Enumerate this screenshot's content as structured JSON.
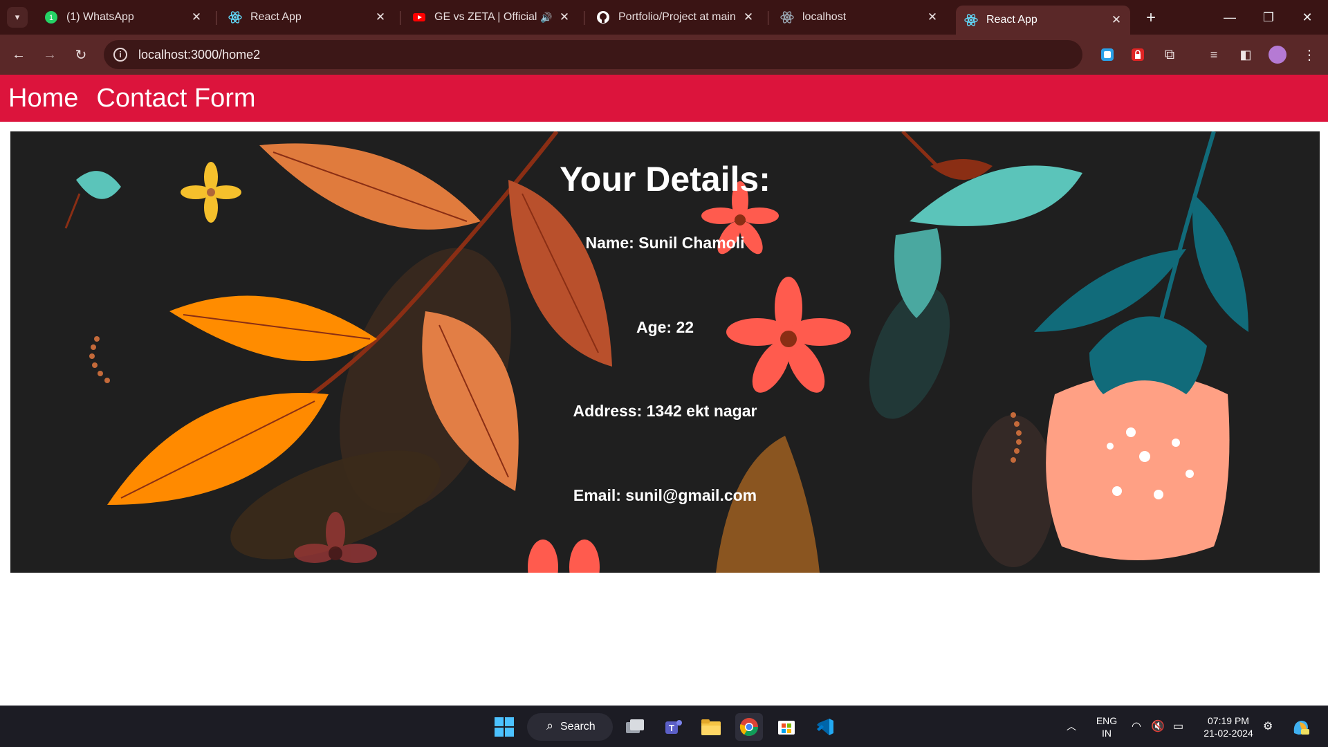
{
  "browser": {
    "tabs": [
      {
        "title": "(1) WhatsApp",
        "icon": "whatsapp-icon"
      },
      {
        "title": "React App",
        "icon": "react-icon"
      },
      {
        "title": "GE vs ZETA | Official W",
        "icon": "youtube-icon"
      },
      {
        "title": "Portfolio/Project at main · S",
        "icon": "github-icon"
      },
      {
        "title": "localhost",
        "icon": "react-icon"
      },
      {
        "title": "React App",
        "icon": "react-icon",
        "active": true
      }
    ],
    "url": "localhost:3000/home2",
    "theme_color": "#5a2828"
  },
  "nav": {
    "links": [
      "Home",
      "Contact Form"
    ],
    "color": "#dc143c"
  },
  "details": {
    "heading": "Your Details:",
    "name": "Name: Sunil Chamoli",
    "age": "Age: 22",
    "address": "Address: 1342 ekt nagar",
    "email": "Email: sunil@gmail.com"
  },
  "taskbar": {
    "search_label": "Search",
    "lang_top": "ENG",
    "lang_bottom": "IN",
    "time": "07:19 PM",
    "date": "21-02-2024"
  }
}
